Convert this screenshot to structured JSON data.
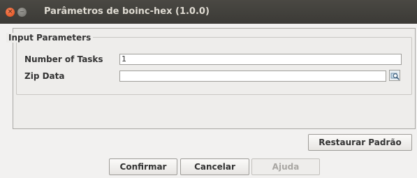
{
  "window": {
    "title": "Parâmetros de boinc-hex (1.0.0)",
    "close_glyph": "×",
    "min_glyph": "‒"
  },
  "form": {
    "group_title": "Input Parameters",
    "tasks_label": "Number of Tasks",
    "tasks_value": "1",
    "zip_label": "Zip Data",
    "zip_value": "",
    "browse_icon": "magnifier-folder-icon"
  },
  "buttons": {
    "restore": "Restaurar Padrão",
    "confirm": "Confirmar",
    "cancel": "Cancelar",
    "help": "Ajuda"
  },
  "colors": {
    "titlebar": "#3c3b37",
    "close_button": "#e9541f",
    "background": "#f2f1f0"
  }
}
